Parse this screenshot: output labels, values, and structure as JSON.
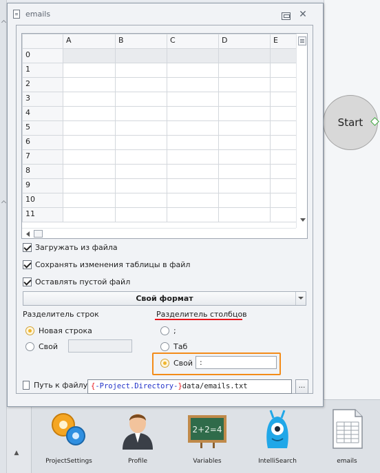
{
  "window": {
    "title": "emails"
  },
  "grid": {
    "columns": [
      "A",
      "B",
      "C",
      "D",
      "E"
    ],
    "rows": [
      "0",
      "1",
      "2",
      "3",
      "4",
      "5",
      "6",
      "7",
      "8",
      "9",
      "10",
      "11"
    ]
  },
  "options": {
    "load_from_file": "Загружать из файла",
    "save_changes": "Сохранять изменения таблицы в файл",
    "keep_empty": "Оставлять пустой файл"
  },
  "format_button": "Свой формат",
  "row_separator": {
    "title": "Разделитель строк",
    "new_line": "Новая строка",
    "custom": "Свой",
    "custom_value": ""
  },
  "col_separator": {
    "title": "Разделитель столбцов",
    "semicolon": ";",
    "tab": "Таб",
    "custom": "Свой",
    "custom_value": ":"
  },
  "path": {
    "label": "Путь к файлу",
    "open_brace": "{",
    "variable": "-Project.Directory-",
    "close_brace": "}",
    "rest": "data/emails.txt",
    "browse": "..."
  },
  "canvas": {
    "start_node": "Start"
  },
  "toolbar": [
    {
      "label": "ProjectSettings",
      "icon": "gears-icon"
    },
    {
      "label": "Profile",
      "icon": "profile-icon"
    },
    {
      "label": "Variables",
      "icon": "chalkboard-icon"
    },
    {
      "label": "IntelliSearch",
      "icon": "blue-monster-icon"
    },
    {
      "label": "emails",
      "icon": "spreadsheet-icon"
    }
  ],
  "colors": {
    "accent_orange": "#f38b18",
    "underline_red": "#e8141a",
    "radio_selected": "#f0b52c"
  }
}
